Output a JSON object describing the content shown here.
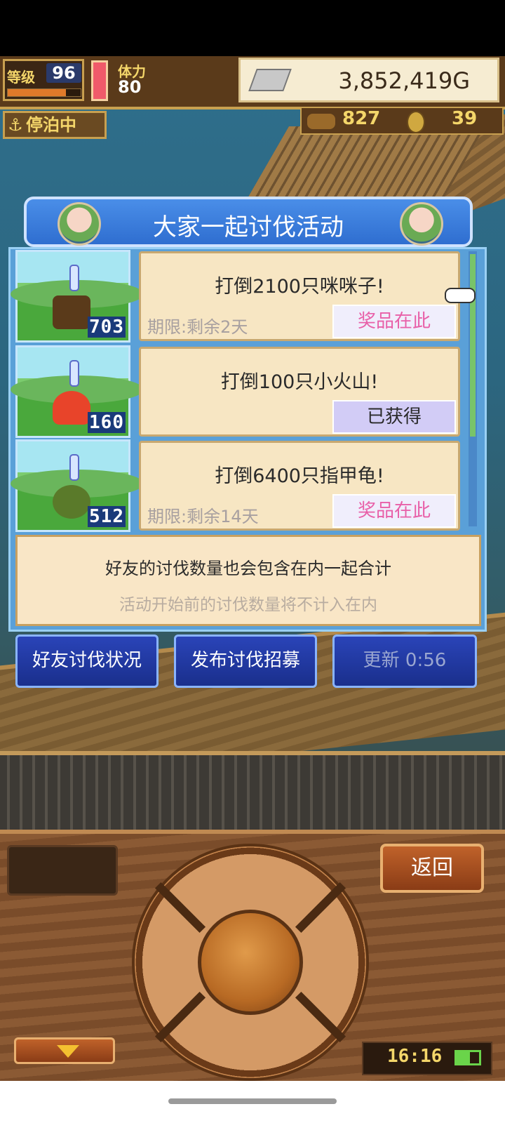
{
  "status": {
    "level_label": "等级",
    "level_value": "96",
    "exp_fraction": 0.8,
    "stamina_label": "体力",
    "stamina_value": "80",
    "gold": "3,852,419G",
    "docked_label": "停泊中",
    "wood": "827",
    "coins": "39"
  },
  "event": {
    "title": "大家一起讨伐活动",
    "missions": [
      {
        "count": "703",
        "title": "打倒2100只咪咪子!",
        "deadline": "期限:剩余2天",
        "button": "奖品在此",
        "obtained": false,
        "sprite_color": "#5a3a1a"
      },
      {
        "count": "160",
        "title": "打倒100只小火山!",
        "deadline": "",
        "button": "已获得",
        "obtained": true,
        "sprite_color": "#e8442a"
      },
      {
        "count": "512",
        "title": "打倒6400只指甲龟!",
        "deadline": "期限:剩余14天",
        "button": "奖品在此",
        "obtained": false,
        "sprite_color": "#5a7a2a"
      }
    ],
    "note_main": "好友的讨伐数量也会包含在内一起合计",
    "note_sub": "活动开始前的讨伐数量将不计入在内",
    "buttons": {
      "friend_status": "好友讨伐状况",
      "recruit": "发布讨伐招募",
      "refresh": "更新 0:56"
    }
  },
  "controls": {
    "back": "返回",
    "clock": "16:16"
  },
  "colors": {
    "panel_blue": "#5aa0d8",
    "header_blue": "#2f6ed0",
    "prize_pink": "#e860a8",
    "button_blue": "#1a2f8c"
  },
  "icons": [
    "anchor-icon",
    "silver-bar-icon",
    "wood-log-icon",
    "coin-icon",
    "hand-pointer-icon",
    "down-arrow-icon",
    "battery-icon"
  ]
}
